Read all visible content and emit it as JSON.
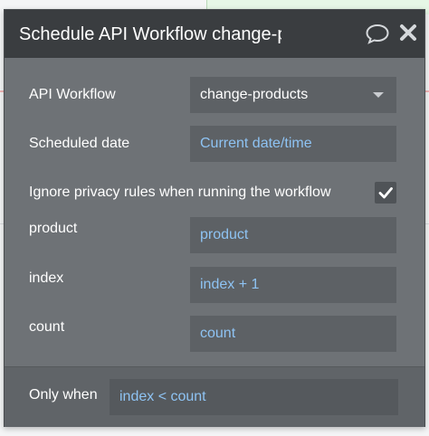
{
  "dialog": {
    "title": "Schedule API Workflow change-products",
    "comment_icon": "comment-icon",
    "close_icon": "close-icon"
  },
  "fields": {
    "api_workflow": {
      "label": "API Workflow",
      "value": "change-products"
    },
    "scheduled_date": {
      "label": "Scheduled date",
      "value": "Current date/time"
    },
    "ignore_privacy": {
      "label": "Ignore privacy rules when running the workflow",
      "checked": true
    },
    "product": {
      "label": "product",
      "value": "product"
    },
    "index": {
      "label": "index",
      "value": "index + 1"
    },
    "count": {
      "label": "count",
      "value": "count"
    }
  },
  "footer": {
    "only_when_label": "Only when",
    "only_when_value": "index < count"
  },
  "colors": {
    "panel_bg": "#6e7276",
    "header_bg": "#3a3d40",
    "expression_text": "#8ec3f3"
  }
}
